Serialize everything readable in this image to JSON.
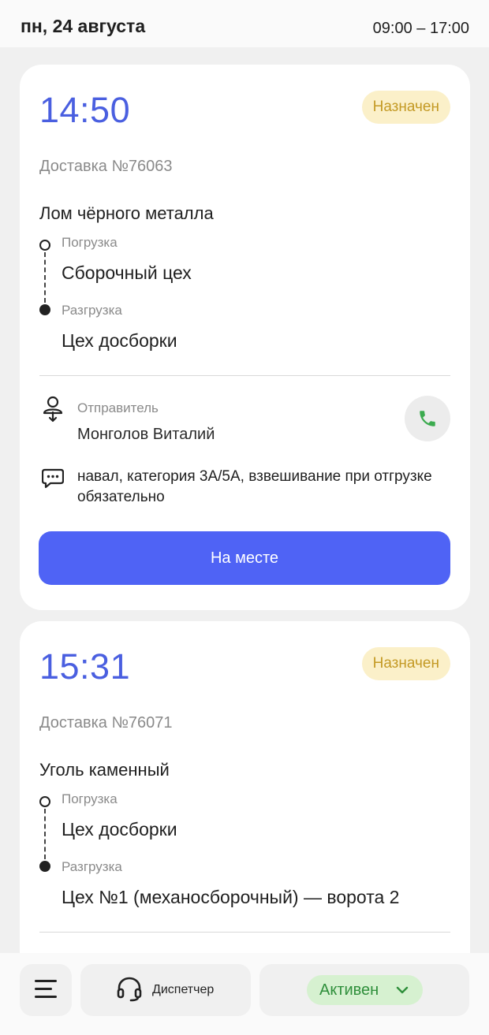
{
  "header": {
    "date": "пн, 24 августа",
    "hours": "09:00 – 17:00"
  },
  "labels": {
    "loading": "Погрузка",
    "unloading": "Разгрузка",
    "sender": "Отправитель"
  },
  "deliveries": [
    {
      "time": "14:50",
      "status": "Назначен",
      "number": "Доставка №76063",
      "cargo": "Лом чёрного металла",
      "from": "Сборочный цех",
      "to": "Цех досборки",
      "sender": "Монголов Виталий",
      "comment": "навал, категория 3А/5А, взвешивание при отгрузке обязательно",
      "action": "На месте"
    },
    {
      "time": "15:31",
      "status": "Назначен",
      "number": "Доставка №76071",
      "cargo": "Уголь каменный",
      "from": "Цех досборки",
      "to": "Цех №1 (механосборочный) — ворота 2"
    }
  ],
  "bottom_bar": {
    "dispatcher_label": "Диспетчер",
    "status_label": "Активен"
  },
  "colors": {
    "accent": "#4f63f5",
    "time": "#4a5fe0",
    "badge_bg": "#fbf0c9",
    "badge_text": "#c49a25",
    "status_bg": "#d6f1d0",
    "status_text": "#2f8f3b",
    "phone": "#3cab4f"
  },
  "icons": {
    "menu": "hamburger-menu-icon",
    "dispatcher": "headset-icon",
    "status": "chevron-down-icon",
    "call": "phone-icon",
    "sender": "person-arrow-icon",
    "comment": "chat-bubble-icon"
  }
}
